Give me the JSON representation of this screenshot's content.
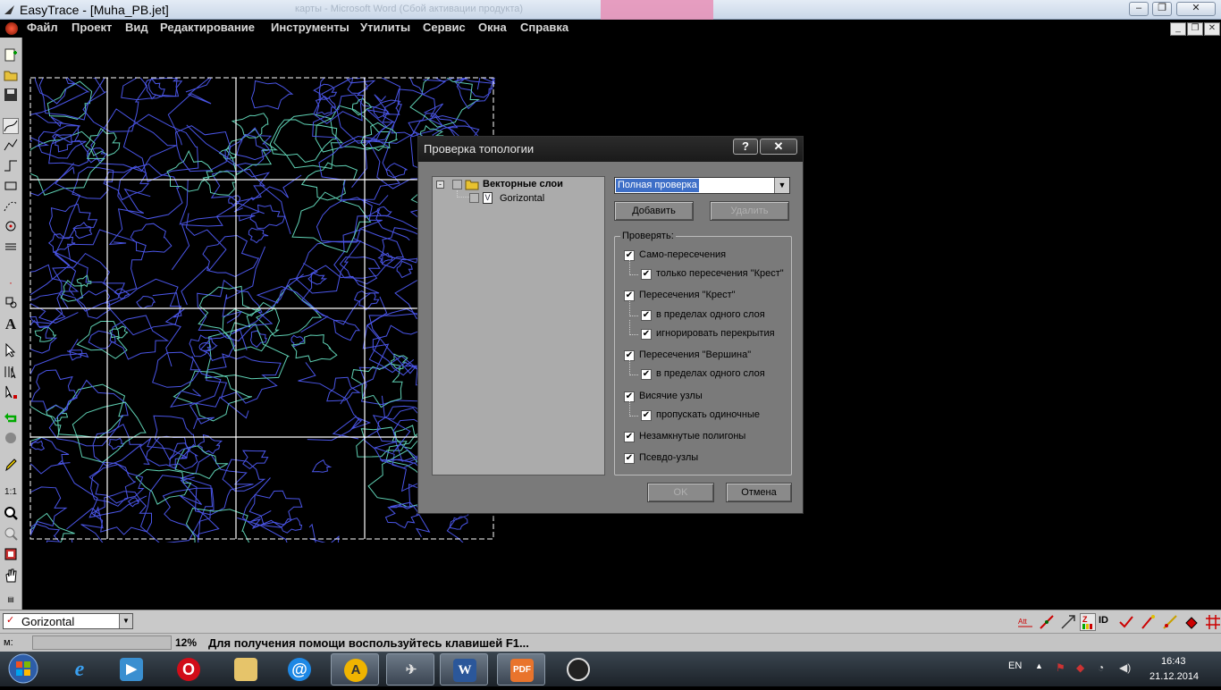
{
  "window": {
    "title": "EasyTrace - [Muha_PB.jet]",
    "ghost_title": "карты   -   Microsoft  Word  (Сбой активации продукта)"
  },
  "menu": [
    "Файл",
    "Проект",
    "Вид",
    "Редактирование",
    "Инструменты",
    "Утилиты",
    "Сервис",
    "Окна",
    "Справка"
  ],
  "dialog": {
    "title": "Проверка топологии",
    "help_label": "?",
    "close_label": "✕",
    "tree": {
      "root": "Векторные слои",
      "child": "Gorizontal"
    },
    "combo_value": "Полная проверка",
    "add_label": "Добавить",
    "delete_label": "Удалить",
    "group_label": "Проверять:",
    "checks": [
      {
        "label": "Само-пересечения",
        "checked": true
      },
      {
        "label": "только пересечения \"Крест\"",
        "checked": true
      },
      {
        "label": "Пересечения \"Крест\"",
        "checked": true
      },
      {
        "label": "в пределах одного слоя",
        "checked": true
      },
      {
        "label": "игнорировать перекрытия",
        "checked": true
      },
      {
        "label": "Пересечения \"Вершина\"",
        "checked": true
      },
      {
        "label": "в пределах одного слоя",
        "checked": true
      },
      {
        "label": "Висячие узлы",
        "checked": true
      },
      {
        "label": "пропускать одиночные",
        "checked": true
      },
      {
        "label": "Незамкнутые полигоны",
        "checked": true
      },
      {
        "label": "Псевдо-узлы",
        "checked": true
      }
    ],
    "ok_label": "OK",
    "cancel_label": "Отмена"
  },
  "layerbar": {
    "current_layer": "Gorizontal"
  },
  "statusbar": {
    "mode_label": "м:",
    "zoom": "12%",
    "hint": "Для получения помощи воспользуйтесь клавишей F1..."
  },
  "toolbar": {
    "scale_label": "1:1"
  },
  "taskbar": {
    "lang": "EN",
    "time": "16:43",
    "date": "21.12.2014"
  },
  "colors": {
    "contour_primary": "#4a55e6",
    "contour_secondary": "#5fd1b4",
    "grid": "#ffffff",
    "selection": "#3e6fc7"
  }
}
